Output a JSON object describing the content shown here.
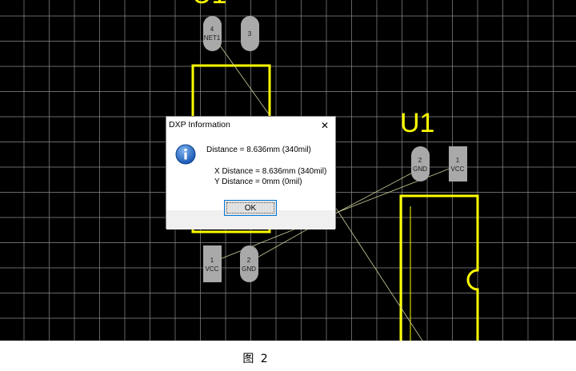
{
  "dialog": {
    "title": "DXP Information",
    "close_symbol": "✕",
    "icon": "info-icon",
    "distance": "Distance = 8.636mm (340mil)",
    "x_distance": "X Distance = 8.636mm (340mil)",
    "y_distance": "Y Distance = 0mm (0mil)",
    "ok_label": "OK"
  },
  "pcb": {
    "background_color": "#000000",
    "grid_color": "#8c8c8c",
    "silkscreen_color": "#ffff00",
    "pad_color": "#a9a9a9",
    "designator_top_fragment": "U1",
    "designator_right": "U1",
    "pads": [
      {
        "number": "4",
        "net": "NET1"
      },
      {
        "number": "3",
        "net": ""
      },
      {
        "number": "2",
        "net": "GND"
      },
      {
        "number": "1",
        "net": "VCC"
      },
      {
        "number": "1",
        "net": "VCC"
      },
      {
        "number": "2",
        "net": "GND"
      }
    ]
  },
  "caption": "图 2"
}
